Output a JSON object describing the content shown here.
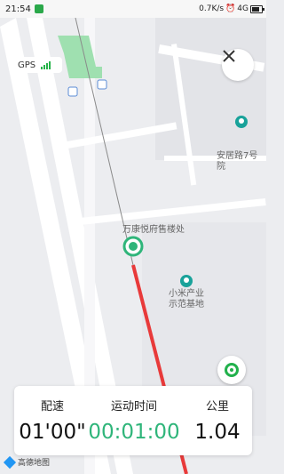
{
  "status_bar": {
    "time": "21:54",
    "speed": "0.7K/s",
    "network": "4G"
  },
  "gps": {
    "label": "GPS"
  },
  "map": {
    "pois": [
      {
        "name": "安居路7号院"
      },
      {
        "name": "万康悦府售楼处"
      },
      {
        "name": "小米产业\n示范基地"
      }
    ],
    "bus_stop_text": "公",
    "route_color": "#e83a3a"
  },
  "stats": {
    "pace_label": "配速",
    "pace_value": "01'00\"",
    "time_label": "运动时间",
    "time_value": "00:01:00",
    "distance_label": "公里",
    "distance_value": "1.04"
  },
  "attribution": {
    "text": "高德地图"
  },
  "colors": {
    "accent": "#2fb57a",
    "route": "#e83a3a",
    "gps_bar": "#26b34a"
  }
}
